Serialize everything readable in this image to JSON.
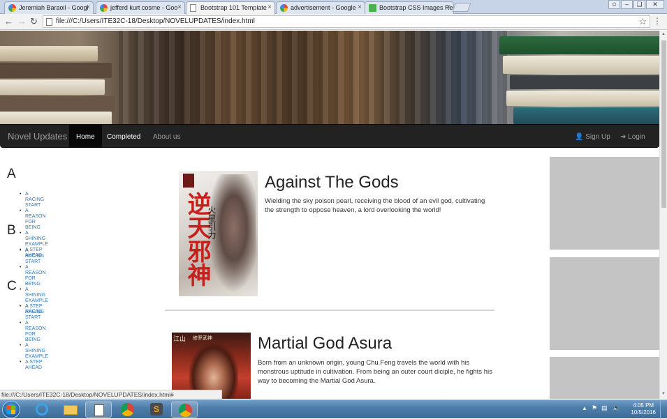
{
  "browser": {
    "tabs": [
      {
        "title": "Jeremiah Baraoil - Googl",
        "icon": "google-icon",
        "active": false
      },
      {
        "title": "jefferd kurt cosme - Goo",
        "icon": "google-icon",
        "active": false
      },
      {
        "title": "Bootstrap 101 Template",
        "icon": "page-icon",
        "active": true
      },
      {
        "title": "advertisement - Google",
        "icon": "google-icon",
        "active": false
      },
      {
        "title": "Bootstrap CSS Images Re",
        "icon": "w3schools-icon",
        "active": false
      }
    ],
    "close_glyph": "×",
    "url": "file:///C:/Users/ITE32C-18/Desktop/NOVELUPDATES/index.html",
    "status_url": "file:///C:/Users/ITE32C-18/Desktop/NOVELUPDATES/index.html#"
  },
  "navbar": {
    "brand": "Novel Updates",
    "items": [
      {
        "label": "Home",
        "active": true
      },
      {
        "label": "Completed",
        "active": false
      },
      {
        "label": "About us",
        "active": false
      }
    ],
    "signup": "Sign Up",
    "login": "Login"
  },
  "sidebar": {
    "sections": [
      {
        "letter": "A",
        "items": [
          "A RACING START",
          "A REASON FOR BEING",
          "A SHINING EXAMPLE",
          "A STEP AHEAD"
        ]
      },
      {
        "letter": "B",
        "items": [
          "A RACING START",
          "A REASON FOR BEING",
          "A SHINING EXAMPLE",
          "A STEP AHEAD"
        ]
      },
      {
        "letter": "C",
        "items": [
          "A RACING START",
          "A REASON FOR BEING",
          "A SHINING EXAMPLE",
          "A STEP AHEAD"
        ]
      }
    ]
  },
  "novels": [
    {
      "title": "Against The Gods",
      "description": "Wielding the sky poison pearl, receiving the blood of an evil god, cultivating the strength to oppose heaven, a lord overlooking the world!",
      "cover_text": "逆天邪神",
      "cover_side_text": "火星引力"
    },
    {
      "title": "Martial God Asura",
      "description": "Born from an unknown origin, young Chu.Feng travels the world with his monstrous uptitude in cultivation. From being an outer court diciple, he fights his way to becoming the Martial God Asura.",
      "cover_text": "江山",
      "cover_side_text": "修罗武神"
    }
  ],
  "taskbar": {
    "time": "4:05 PM",
    "date": "10/5/2016",
    "apps": [
      "start-button",
      "ie-icon",
      "explorer-icon",
      "notepad-icon",
      "chrome-icon",
      "sublime-icon",
      "chrome-icon-active"
    ]
  },
  "colors": {
    "navbar_bg": "#222222",
    "link": "#337ab7",
    "ad_box": "#c4c4c4"
  }
}
